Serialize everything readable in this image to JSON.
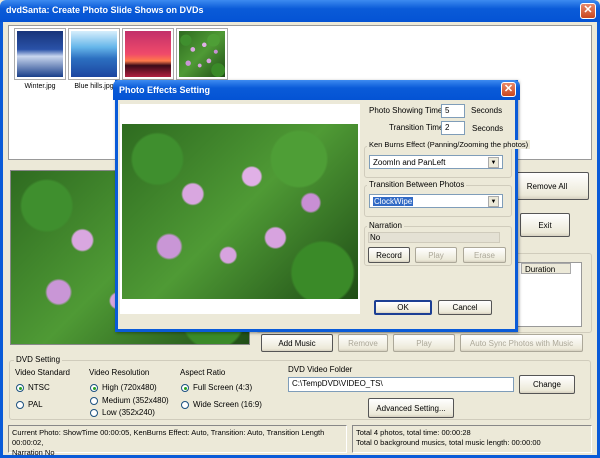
{
  "window": {
    "title": "dvdSanta: Create Photo Slide Shows on DVDs"
  },
  "thumbnails": [
    {
      "label": "Winter.jpg"
    },
    {
      "label": "Blue hills.jpg"
    },
    {
      "label": ""
    },
    {
      "label": ""
    }
  ],
  "side_buttons": {
    "remove_all": "Remove All",
    "exit": "Exit"
  },
  "music_list": {
    "columns": [
      "Duration"
    ]
  },
  "music_buttons": {
    "add": "Add Music",
    "remove": "Remove",
    "play": "Play",
    "auto_sync": "Auto Sync Photos with Music"
  },
  "dvd_setting": {
    "title": "DVD Setting",
    "video_standard": {
      "label": "Video Standard",
      "options": [
        {
          "label": "NTSC",
          "selected": true
        },
        {
          "label": "PAL",
          "selected": false
        }
      ]
    },
    "video_resolution": {
      "label": "Video Resolution",
      "options": [
        {
          "label": "High (720x480)",
          "selected": true
        },
        {
          "label": "Medium (352x480)",
          "selected": false
        },
        {
          "label": "Low (352x240)",
          "selected": false
        }
      ]
    },
    "aspect_ratio": {
      "label": "Aspect Ratio",
      "options": [
        {
          "label": "Full Screen (4:3)",
          "selected": true
        },
        {
          "label": "Wide Screen (16:9)",
          "selected": false
        }
      ]
    },
    "folder_label": "DVD Video Folder",
    "folder_value": "C:\\TempDVD\\VIDEO_TS\\",
    "change": "Change",
    "advanced": "Advanced Setting..."
  },
  "status": {
    "left_line1": "Current Photo: ShowTime 00:00:05, KenBurns Effect: Auto, Transition: Auto, Transition Length 00:00:02,",
    "left_line2": "Narration No",
    "right_line1": "Total 4 photos, total time: 00:00:28",
    "right_line2": "Total 0 background musics, total music length: 00:00:00"
  },
  "dialog": {
    "title": "Photo Effects Setting",
    "show_time_label": "Photo Showing Time:",
    "show_time_value": "5",
    "seconds1": "Seconds",
    "transition_time_label": "Transition Time",
    "transition_time_value": "2",
    "seconds2": "Seconds",
    "ken_burns_label": "Ken Burns Effect (Panning/Zooming the photos)",
    "ken_burns_value": "ZoomIn and PanLeft",
    "transition_label": "Transition Between Photos",
    "transition_value": "ClockWipe",
    "narration_label": "Narration",
    "narration_value": "No",
    "record": "Record",
    "play": "Play",
    "erase": "Erase",
    "ok": "OK",
    "cancel": "Cancel"
  }
}
